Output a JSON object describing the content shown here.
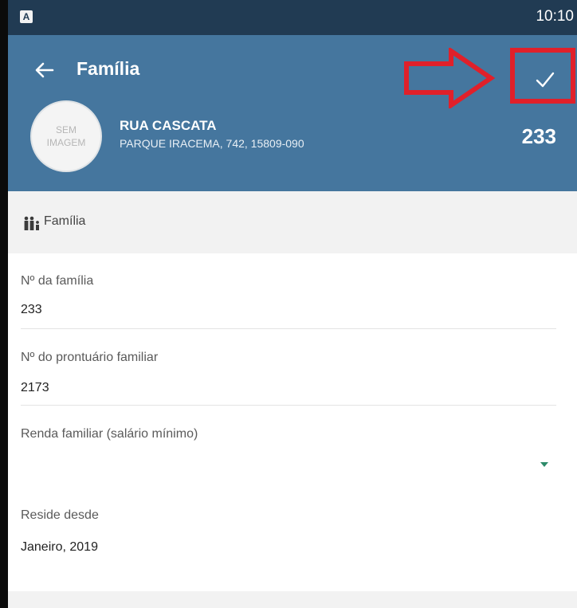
{
  "status_bar": {
    "indicator": "A",
    "time": "10:10"
  },
  "header": {
    "title": "Família",
    "back_icon": "arrow-left-icon",
    "confirm_icon": "check-icon",
    "annotation": "red-arrow pointing at confirm button, red highlight box",
    "avatar": {
      "line1": "SEM",
      "line2": "IMAGEM"
    },
    "street": "RUA CASCATA",
    "address": "PARQUE IRACEMA, 742, 15809-090",
    "number": "233",
    "colors": {
      "status_bar": "#213b53",
      "app_bar": "#45769e",
      "highlight": "#e0202a"
    }
  },
  "section": {
    "label": "Família",
    "icon": "family-icon"
  },
  "fields": [
    {
      "label": "Nº da família",
      "value": "233"
    },
    {
      "label": "Nº do prontuário familiar",
      "value": "2173"
    },
    {
      "label": "Renda familiar (salário mínimo)",
      "value": ""
    },
    {
      "label": "Reside desde",
      "value": "Janeiro, 2019"
    }
  ]
}
